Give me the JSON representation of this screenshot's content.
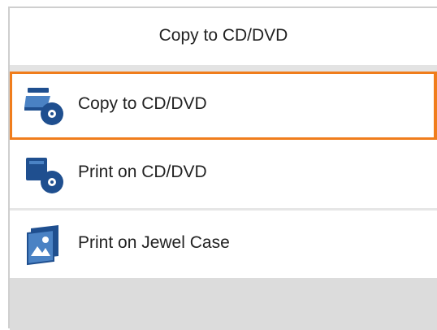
{
  "header": {
    "title": "Copy to CD/DVD"
  },
  "menu": {
    "items": [
      {
        "label": "Copy to CD/DVD",
        "icon": "scanner-to-disc-icon",
        "selected": true
      },
      {
        "label": "Print on CD/DVD",
        "icon": "printer-to-disc-icon",
        "selected": false
      },
      {
        "label": "Print on Jewel Case",
        "icon": "jewel-case-icon",
        "selected": false
      }
    ]
  },
  "colors": {
    "selection_border": "#f07d1c",
    "icon_blue": "#1f4f8f",
    "icon_light_blue": "#4a82c4",
    "divider": "#e3e3e3",
    "footer": "#dcdcdc"
  }
}
